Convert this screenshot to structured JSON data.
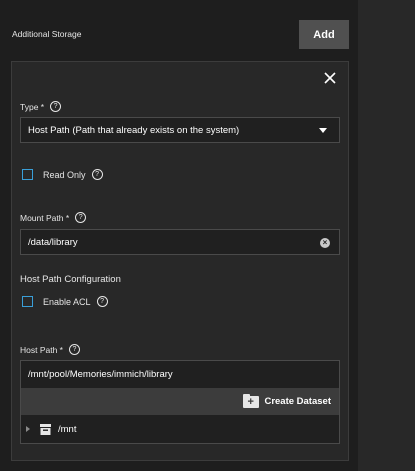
{
  "header": {
    "title": "Additional Storage",
    "add_label": "Add"
  },
  "form": {
    "type": {
      "label": "Type *",
      "value": "Host Path (Path that already exists on the system)"
    },
    "read_only": {
      "label": "Read Only",
      "checked": false
    },
    "mount_path": {
      "label": "Mount Path *",
      "value": "/data/library"
    },
    "host_path_section": "Host Path Configuration",
    "enable_acl": {
      "label": "Enable ACL",
      "checked": false
    },
    "host_path": {
      "label": "Host Path *",
      "value": "/mnt/pool/Memories/immich/library",
      "create_dataset_label": "Create Dataset",
      "tree": [
        {
          "name": "/mnt"
        }
      ]
    }
  },
  "colors": {
    "background": "#1e1e1e",
    "card": "#282828",
    "accent": "#3a9fd8",
    "add_button": "#505050"
  },
  "icons": {
    "close": "close-icon",
    "help": "help-circle-icon",
    "folder_plus": "create-folder-icon",
    "drive": "drive-icon"
  }
}
